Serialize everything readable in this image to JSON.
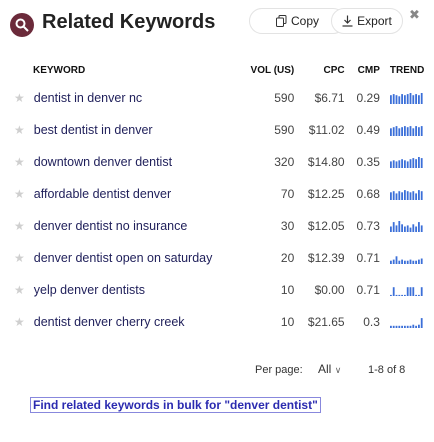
{
  "header": {
    "title": "Related Keywords",
    "copy_label": "Copy",
    "export_label": "Export",
    "close_glyph": "✖",
    "logo_color": "#6b2a3a"
  },
  "table": {
    "columns": [
      "KEYWORD",
      "VOL (US)",
      "CPC",
      "CMP",
      "TREND"
    ],
    "rows": [
      {
        "keyword": "dentist in denver nc",
        "vol": "590",
        "cpc": "$6.71",
        "cmp": "0.29",
        "trend": [
          8,
          9,
          8,
          7,
          9,
          8,
          9,
          10,
          8,
          9,
          8,
          10
        ]
      },
      {
        "keyword": "best dentist in denver",
        "vol": "590",
        "cpc": "$11.02",
        "cmp": "0.49",
        "trend": [
          7,
          8,
          9,
          7,
          8,
          9,
          8,
          9,
          7,
          9,
          8,
          9
        ]
      },
      {
        "keyword": "downtown denver dentist",
        "vol": "320",
        "cpc": "$14.80",
        "cmp": "0.35",
        "trend": [
          6,
          7,
          6,
          7,
          8,
          7,
          6,
          8,
          9,
          8,
          10,
          9
        ]
      },
      {
        "keyword": "affordable dentist denver",
        "vol": "70",
        "cpc": "$12.25",
        "cmp": "0.68",
        "trend": [
          7,
          8,
          6,
          8,
          7,
          9,
          8,
          7,
          8,
          6,
          9,
          8
        ]
      },
      {
        "keyword": "denver dentist no insurance",
        "vol": "30",
        "cpc": "$12.05",
        "cmp": "0.73",
        "trend": [
          5,
          9,
          6,
          10,
          7,
          5,
          6,
          4,
          7,
          5,
          9,
          6
        ]
      },
      {
        "keyword": "denver dentist open on saturday",
        "vol": "20",
        "cpc": "$12.39",
        "cmp": "0.71",
        "trend": [
          3,
          4,
          7,
          3,
          4,
          3,
          3,
          4,
          3,
          3,
          4,
          5
        ]
      },
      {
        "keyword": "yelp denver dentists",
        "vol": "10",
        "cpc": "$0.00",
        "cmp": "0.71",
        "trend": [
          1,
          8,
          1,
          1,
          1,
          1,
          8,
          8,
          8,
          1,
          1,
          8
        ]
      },
      {
        "keyword": "dentist denver cherry creek",
        "vol": "10",
        "cpc": "$21.65",
        "cmp": "0.3",
        "trend": [
          2,
          2,
          2,
          2,
          2,
          2,
          2,
          2,
          3,
          2,
          3,
          9
        ]
      }
    ]
  },
  "footer": {
    "per_page_label": "Per page:",
    "per_page_value": "All",
    "paging": "1-8 of 8"
  },
  "bulk_link": "Find related keywords in bulk for \"denver dentist\"",
  "colors": {
    "trend_bar": "#3b6fd8",
    "link": "#2b2bb0",
    "keyword": "#1f1f5a"
  }
}
